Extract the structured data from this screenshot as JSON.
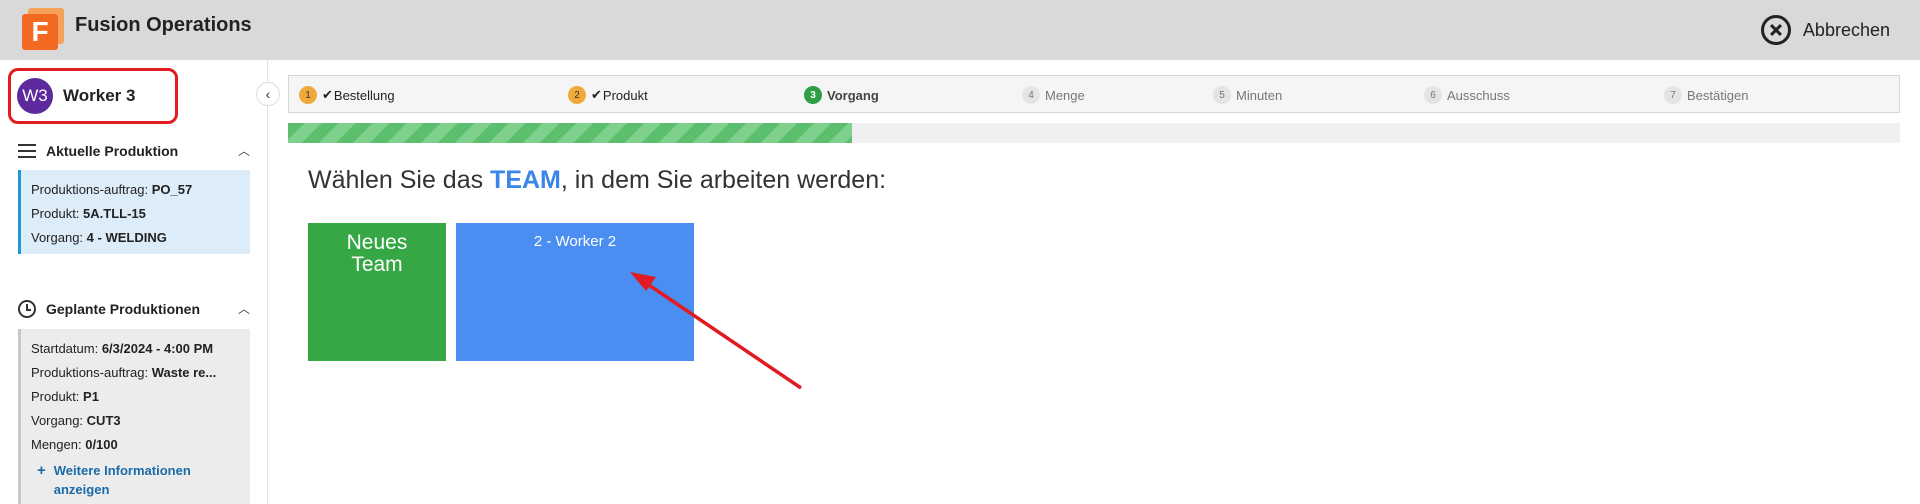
{
  "header": {
    "logo_letter": "F",
    "app_title": "Fusion Operations",
    "cancel_label": "Abbrechen"
  },
  "sidebar": {
    "avatar_initials": "W3",
    "worker_name": "Worker 3",
    "current_section_title": "Aktuelle Produktion",
    "current": {
      "order_label": "Produktions-auftrag:",
      "order_value": "PO_57",
      "product_label": "Produkt:",
      "product_value": "5A.TLL-15",
      "operation_label": "Vorgang:",
      "operation_value": "4 - WELDING"
    },
    "planned_section_title": "Geplante Produktionen",
    "planned": {
      "start_label": "Startdatum:",
      "start_value": "6/3/2024 - 4:00 PM",
      "order_label": "Produktions-auftrag:",
      "order_value": "Waste re...",
      "product_label": "Produkt:",
      "product_value": "P1",
      "operation_label": "Vorgang:",
      "operation_value": "CUT3",
      "quantity_label": "Mengen:",
      "quantity_value": "0/100",
      "more_link": "Weitere Informationen anzeigen"
    }
  },
  "steps": [
    {
      "num": "1",
      "label": "Bestellung",
      "state": "done"
    },
    {
      "num": "2",
      "label": "Produkt",
      "state": "done"
    },
    {
      "num": "3",
      "label": "Vorgang",
      "state": "active"
    },
    {
      "num": "4",
      "label": "Menge",
      "state": "pending"
    },
    {
      "num": "5",
      "label": "Minuten",
      "state": "pending"
    },
    {
      "num": "6",
      "label": "Ausschuss",
      "state": "pending"
    },
    {
      "num": "7",
      "label": "Bestätigen",
      "state": "pending"
    }
  ],
  "progress_fraction": 0.35,
  "main": {
    "prompt_before": "Wählen Sie das ",
    "prompt_emphasis": "TEAM",
    "prompt_after": ", in dem Sie arbeiten werden:",
    "tiles": [
      {
        "label": "Neues Team",
        "color": "#36a745"
      },
      {
        "label": "2 - Worker 2",
        "color": "#4b8ef2"
      }
    ]
  },
  "colors": {
    "annotation": "#e21b23",
    "accent_blue": "#3a86e8",
    "active_step": "#2f9e44",
    "done_step": "#f2a93b"
  }
}
